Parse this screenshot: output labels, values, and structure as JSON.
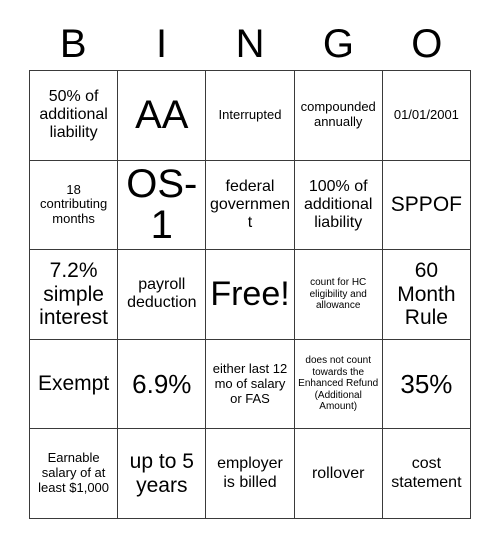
{
  "header": {
    "letters": [
      "B",
      "I",
      "N",
      "G",
      "O"
    ]
  },
  "colors": {
    "grid_line": "#3a3a3a",
    "text": "#000000",
    "background": "#ffffff"
  },
  "grid": {
    "rows": 5,
    "columns": 5,
    "cells": [
      {
        "text": "50% of additional liability",
        "size": "md"
      },
      {
        "text": "AA",
        "size": "huge"
      },
      {
        "text": "Interrupted",
        "size": "sm"
      },
      {
        "text": "compounded annually",
        "size": "sm"
      },
      {
        "text": "01/01/2001",
        "size": "sm"
      },
      {
        "text": "18 contributing months",
        "size": "sm"
      },
      {
        "text": "OS-1",
        "size": "huge"
      },
      {
        "text": "federal government",
        "size": "md"
      },
      {
        "text": "100% of additional liability",
        "size": "md"
      },
      {
        "text": "SPPOF",
        "size": "lg"
      },
      {
        "text": "7.2% simple interest",
        "size": "lg"
      },
      {
        "text": "payroll deduction",
        "size": "md"
      },
      {
        "text": "Free!",
        "size": "xxl"
      },
      {
        "text": "count for HC eligibility and allowance",
        "size": "xs"
      },
      {
        "text": "60 Month Rule",
        "size": "lg"
      },
      {
        "text": "Exempt",
        "size": "lg"
      },
      {
        "text": "6.9%",
        "size": "xl"
      },
      {
        "text": "either last 12 mo of salary or FAS",
        "size": "sm"
      },
      {
        "text": "does not count towards the Enhanced Refund (Additional Amount)",
        "size": "xs"
      },
      {
        "text": "35%",
        "size": "xl"
      },
      {
        "text": "Earnable salary of at least $1,000",
        "size": "sm"
      },
      {
        "text": "up to 5 years",
        "size": "lg"
      },
      {
        "text": "employer is billed",
        "size": "md"
      },
      {
        "text": "rollover",
        "size": "md"
      },
      {
        "text": "cost statement",
        "size": "md"
      }
    ]
  }
}
